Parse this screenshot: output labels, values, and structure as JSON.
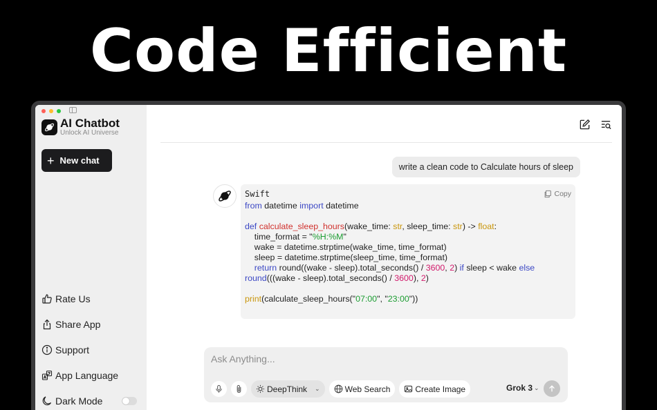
{
  "headline": "Code Efficient",
  "colors": {
    "window_frame": "#3a3a3c",
    "sidebar_bg": "#efefef",
    "button_dark": "#1c1c1e",
    "keyword": "#3b47c4",
    "function": "#d0312d",
    "type": "#c9960c",
    "string": "#1b9c31",
    "number": "#d11a6b"
  },
  "window": {
    "traffic_lights": [
      "#ff5f57",
      "#febc2e",
      "#28c840"
    ]
  },
  "sidebar": {
    "brand_title": "AI Chatbot",
    "brand_subtitle": "Unlock AI Universe",
    "new_chat_label": "New chat",
    "menu": {
      "rate": "Rate Us",
      "share": "Share App",
      "support": "Support",
      "language": "App Language",
      "dark_mode": "Dark Mode"
    },
    "dark_mode_on": false
  },
  "chat": {
    "user_message": "write a clean code to Calculate hours of sleep",
    "code_language": "Swift",
    "copy_label": "Copy",
    "code": {
      "l1_from": "from",
      "l1_mod": " datetime ",
      "l1_import": "import",
      "l1_name": " datetime",
      "l3_def": "def",
      "l3_fn": "calculate_sleep_hours",
      "l3_a": "(wake_time: ",
      "l3_t1": "str",
      "l3_b": ", sleep_time: ",
      "l3_t2": "str",
      "l3_c": ") -> ",
      "l3_t3": "float",
      "l3_d": ":",
      "l4_a": "    time_format = \"",
      "l4_s": "%H:%M",
      "l4_b": "\"",
      "l5": "    wake = datetime.strptime(wake_time, time_format)",
      "l6": "    sleep = datetime.strptime(sleep_time, time_format)",
      "l7_ret": "return",
      "l7_a": " round((wake - sleep).total_seconds() / ",
      "l7_n1": "3600",
      "l7_b": ", ",
      "l7_n2": "2",
      "l7_c": ") ",
      "l7_if": "if",
      "l7_d": " sleep < wake ",
      "l7_else": "else",
      "l8_fn": "round",
      "l8_a": "(((wake - sleep).total_seconds() / ",
      "l8_n1": "3600",
      "l8_b": "), ",
      "l8_n2": "2",
      "l8_c": ")",
      "l10_print": "print",
      "l10_a": "(calculate_sleep_hours(\"",
      "l10_s1": "07:00",
      "l10_b": "\", \"",
      "l10_s2": "23:00",
      "l10_c": "\"))"
    }
  },
  "composer": {
    "placeholder": "Ask Anything...",
    "deepthink_label": "DeepThink",
    "web_search_label": "Web Search",
    "create_image_label": "Create Image",
    "model_label": "Grok 3"
  }
}
